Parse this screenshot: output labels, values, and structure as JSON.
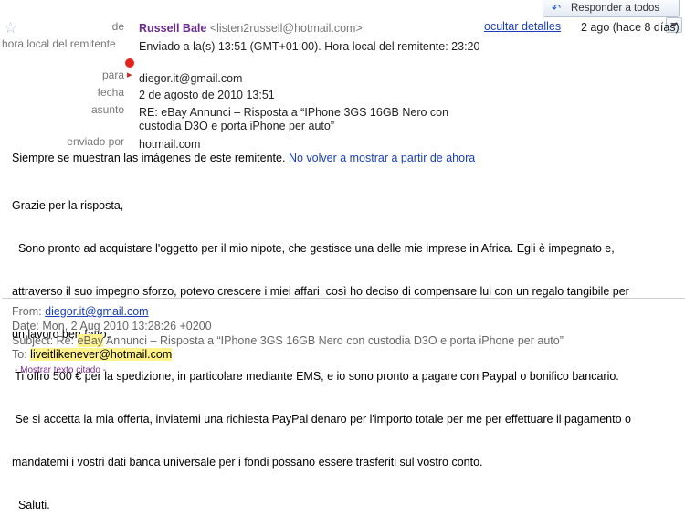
{
  "toolbar": {
    "reply_all_label": "Responder a todos",
    "reply_icon": "reply-arrow-icon",
    "dropdown_icon": "chevron-down-icon"
  },
  "header": {
    "from_label": "de",
    "sender_name": "Russell Bale",
    "sender_email": "<listen2russell@hotmail.com>",
    "hide_details_link": "ocultar detalles",
    "date_short": "2 ago (hace 8 días)",
    "local_time_label": "hora local del remitente",
    "local_time_value": "Enviado a la(s) 13:51 (GMT+01:00). Hora local del remitente: 23:20",
    "to_label": "para",
    "to_value": "diegor.it@gmail.com",
    "date_label": "fecha",
    "date_value": "2 de agosto de 2010 13:51",
    "subject_label": "asunto",
    "subject_line1": "RE: eBay Annunci – Risposta a “IPhone 3GS 16GB Nero con",
    "subject_line2": "custodia D3O e porta iPhone per auto”",
    "sent_by_label": "enviado por",
    "sent_by_value": "hotmail.com"
  },
  "images_notice": {
    "text": "Siempre se muestran las imágenes de este remitente.",
    "link": "No volver a mostrar a partir de ahora"
  },
  "body": {
    "lines": [
      "Grazie per la risposta,",
      "  Sono pronto ad acquistare l'oggetto per il mio nipote, che gestisce una delle mie imprese in Africa. Egli è impegnato e,",
      "attraverso il suo impegno sforzo, potevo crescere i miei affari, così ho deciso di compensare lui con un regalo tangibile per",
      "un lavoro ben fatto.",
      " Ti offro 500 € per la spedizione, in particolare mediante EMS, e io sono pronto a pagare con Paypal o bonifico bancario.",
      " Se si accetta la mia offerta, inviatemi una richiesta PayPal denaro per l'importo totale per me per effettuare il pagamento o",
      "mandatemi i vostri dati banca universale per i fondi possano essere trasferiti sul vostro conto.",
      "  Saluti."
    ]
  },
  "quoted": {
    "from_label": "From:",
    "from_value": "diegor.it@gmail.com",
    "date_label": "Date:",
    "date_value": "Mon, 2 Aug 2010 13:28:26 +0200",
    "subject_label": "Subject:",
    "subject_prefix": "Re:",
    "subject_highlight": "eBay",
    "subject_rest": "Annunci – Risposta a “IPhone 3GS 16GB Nero con custodia D3O e porta iPhone per auto”",
    "to_label": "To:",
    "to_value": "liveitlikenever@hotmail.com",
    "show_quoted": "- Mostrar texto citado -"
  }
}
